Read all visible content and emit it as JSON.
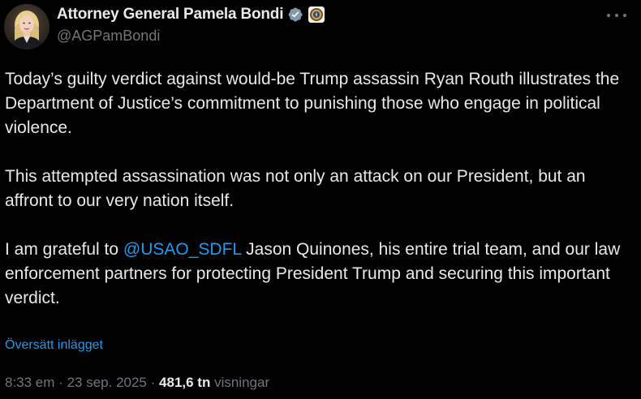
{
  "author": {
    "display_name": "Attorney General Pamela Bondi",
    "handle": "@AGPamBondi",
    "verified_badge_color": "#829aab",
    "avatar_icon": "profile-photo"
  },
  "more_icon": "more-options-icon",
  "post": {
    "paragraph_1": "Today’s guilty verdict against would-be Trump assassin Ryan Routh illustrates the Department of Justice’s commitment to punishing those who engage in political violence.",
    "paragraph_2": "This attempted assassination was not only an attack on our President, but an affront to our very nation itself.",
    "paragraph_3_start": "I am grateful to ",
    "paragraph_3_mention": "@USAO_SDFL",
    "paragraph_3_end": " Jason Quinones, his entire trial team, and our law enforcement partners for protecting President Trump and securing this important verdict."
  },
  "translate_label": "Översätt inlägget",
  "meta": {
    "time": "8:33 em",
    "separator": "·",
    "date": "23 sep. 2025",
    "views_count": "481,6 tn",
    "views_label": "visningar"
  },
  "colors": {
    "background": "#000000",
    "text": "#e7e9ea",
    "secondary": "#71767b",
    "link": "#1d9bf0"
  }
}
